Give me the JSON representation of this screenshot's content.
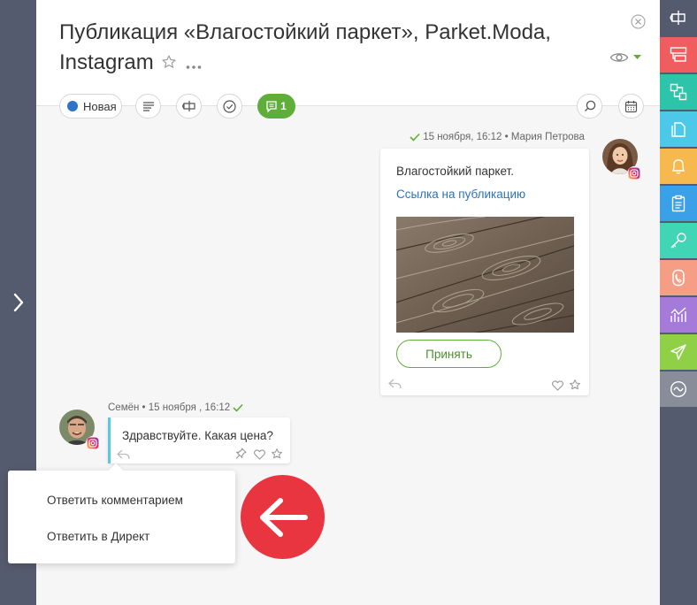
{
  "header": {
    "title": "Публикация «Влагостойкий паркет», Parket.Moda, Instagram"
  },
  "toolbar": {
    "status_label": "Новая",
    "comments_count": "1"
  },
  "messages": {
    "outgoing": {
      "meta": "15 ноября, 16:12 • Мария Петрова",
      "text": "Влагостойкий паркет.",
      "link": "Ссылка на публикацию",
      "accept_label": "Принять"
    },
    "incoming": {
      "meta": "Семён • 15 ноября , 16:12",
      "text": "Здравствуйте. Какая цена?"
    }
  },
  "popup": {
    "items": [
      "Ответить комментарием",
      "Ответить в Директ"
    ]
  },
  "colors": {
    "accent_green": "#5fae3a",
    "status_blue": "#2d74c7",
    "arrow_red": "#e8353f",
    "side_panel": "#555b6e"
  },
  "right_sidebar": {
    "items": [
      {
        "icon": "task-flow-icon",
        "color": "#555b6e"
      },
      {
        "icon": "screens-icon",
        "color": "#f05d5e"
      },
      {
        "icon": "workflow-icon",
        "color": "#2ec4a9"
      },
      {
        "icon": "documents-icon",
        "color": "#4cc9e8"
      },
      {
        "icon": "bell-icon",
        "color": "#f7b94e"
      },
      {
        "icon": "clipboard-icon",
        "color": "#3aa0e8"
      },
      {
        "icon": "key-icon",
        "color": "#3fd5b5"
      },
      {
        "icon": "phone-icon",
        "color": "#f69d85"
      },
      {
        "icon": "analytics-icon",
        "color": "#a67ad9"
      },
      {
        "icon": "send-icon",
        "color": "#8fd046"
      },
      {
        "icon": "wave-icon",
        "color": "#888d99"
      }
    ]
  }
}
